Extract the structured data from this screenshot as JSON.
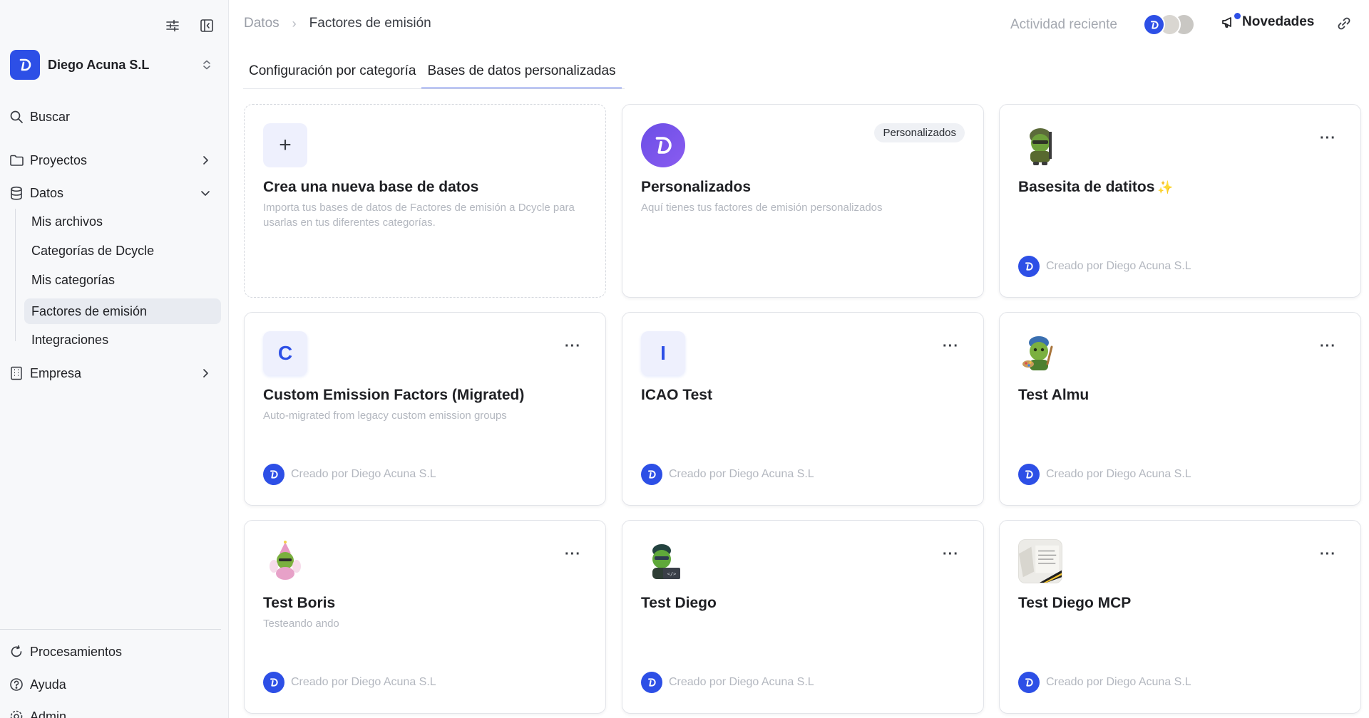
{
  "sidebar": {
    "org_name": "Diego Acuna S.L",
    "search_label": "Buscar",
    "items": [
      {
        "label": "Proyectos"
      },
      {
        "label": "Datos"
      },
      {
        "label": "Empresa"
      }
    ],
    "sub_items": [
      {
        "label": "Mis archivos"
      },
      {
        "label": "Categorías de Dcycle"
      },
      {
        "label": "Mis categorías"
      },
      {
        "label": "Factores de emisión"
      },
      {
        "label": "Integraciones"
      }
    ],
    "bottom_items": [
      {
        "label": "Procesamientos"
      },
      {
        "label": "Ayuda"
      },
      {
        "label": "Admin"
      }
    ]
  },
  "header": {
    "breadcrumb_root": "Datos",
    "breadcrumb_current": "Factores de emisión",
    "activity_label": "Actividad reciente",
    "news_label": "Novedades"
  },
  "tabs": [
    {
      "label": "Configuración por categoría"
    },
    {
      "label": "Bases de datos personalizadas"
    }
  ],
  "cards": {
    "new": {
      "title": "Crea una nueva base de datos",
      "description": "Importa tus bases de datos de Factores de emisión a Dcycle para usarlas en tus diferentes categorías."
    },
    "personalizados": {
      "title": "Personalizados",
      "description": "Aquí tienes tus factores de emisión personalizados",
      "badge": "Personalizados"
    },
    "items": [
      {
        "title": "Basesita de datitos",
        "description": "",
        "footer": "Creado por Diego Acuna S.L"
      },
      {
        "title": "Custom Emission Factors (Migrated)",
        "description": "Auto-migrated from legacy custom emission groups",
        "letter": "C",
        "footer": "Creado por Diego Acuna S.L"
      },
      {
        "title": "ICAO Test",
        "description": "",
        "letter": "I",
        "footer": "Creado por Diego Acuna S.L"
      },
      {
        "title": "Test Almu",
        "description": "",
        "footer": "Creado por Diego Acuna S.L"
      },
      {
        "title": "Test Boris",
        "description": "Testeando ando",
        "footer": "Creado por Diego Acuna S.L"
      },
      {
        "title": "Test Diego",
        "description": "",
        "footer": "Creado por Diego Acuna S.L"
      },
      {
        "title": "Test Diego MCP",
        "description": "",
        "footer": "Creado por Diego Acuna S.L"
      }
    ],
    "menu_glyph": "···"
  },
  "colors": {
    "accent": "#2d4fe6",
    "sidebar_bg": "#f7f8fa",
    "active_nav_bg": "#e8ebf1"
  }
}
